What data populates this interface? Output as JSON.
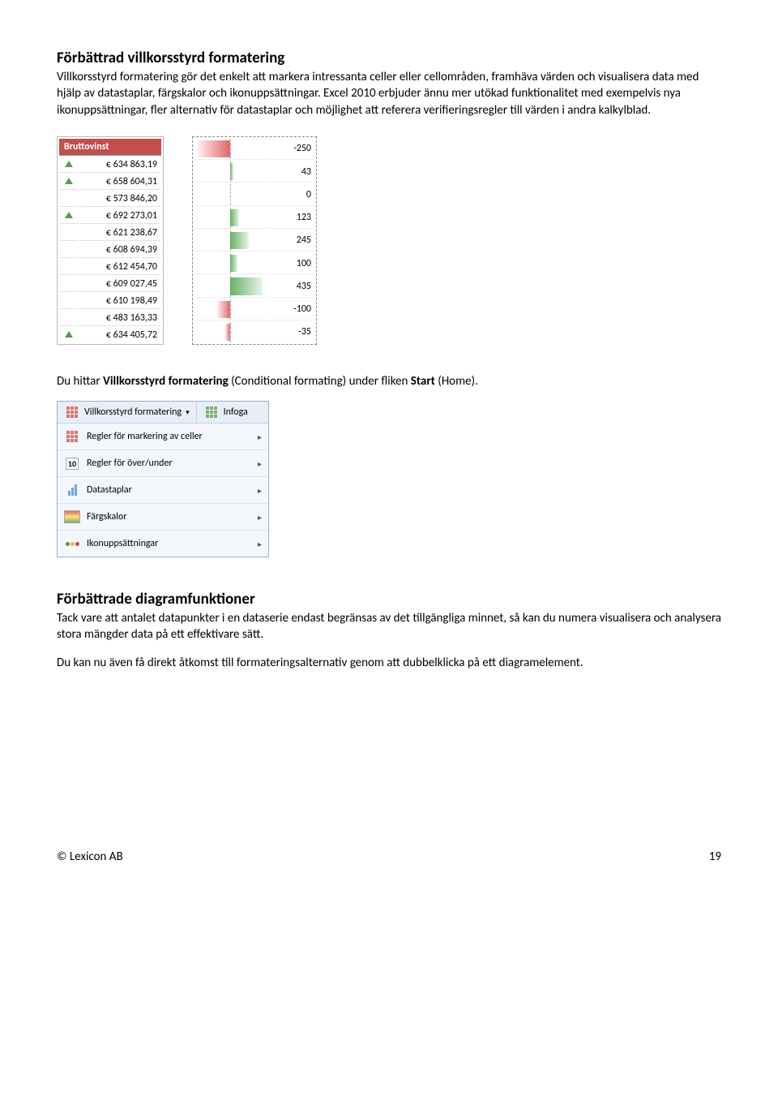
{
  "section1": {
    "heading": "Förbättrad villkorsstyrd formatering",
    "para": "Villkorsstyrd formatering gör det enkelt att markera intressanta celler eller cellområden, framhäva värden och visualisera data med hjälp av datastaplar, färgskalor och ikonuppsättningar. Excel 2010 erbjuder ännu mer utökad funktionalitet med exempelvis nya ikonuppsättningar, fler alternativ för datastaplar och möjlighet att referera verifieringsregler till värden i andra kalkylblad."
  },
  "table1": {
    "header": "Bruttovinst",
    "rows": [
      {
        "icon": true,
        "val": "€ 634 863,19"
      },
      {
        "icon": true,
        "val": "€ 658 604,31"
      },
      {
        "icon": false,
        "val": "€ 573 846,20"
      },
      {
        "icon": true,
        "val": "€ 692 273,01"
      },
      {
        "icon": false,
        "val": "€ 621 238,67"
      },
      {
        "icon": false,
        "val": "€ 608 694,39"
      },
      {
        "icon": false,
        "val": "€ 612 454,70"
      },
      {
        "icon": false,
        "val": "€ 609 027,45"
      },
      {
        "icon": false,
        "val": "€ 610 198,49"
      },
      {
        "icon": false,
        "val": "€ 483 163,33"
      },
      {
        "icon": true,
        "val": "€ 634 405,72"
      }
    ]
  },
  "table2": {
    "rows": [
      {
        "v": -250
      },
      {
        "v": 43
      },
      {
        "v": 0
      },
      {
        "v": 123
      },
      {
        "v": 245
      },
      {
        "v": 100
      },
      {
        "v": 435
      },
      {
        "v": -100
      },
      {
        "v": -35
      }
    ],
    "min": -250,
    "max": 435
  },
  "mid_line_pre": "Du hittar ",
  "mid_line_bold1": "Villkorsstyrd formatering",
  "mid_line_mid": " (Conditional formating) under fliken ",
  "mid_line_bold2": "Start",
  "mid_line_post": " (Home).",
  "cf_dropdown": {
    "btn1": "Villkorsstyrd formatering",
    "btn2": "Infoga",
    "items": [
      "Regler för markering av celler",
      "Regler för över/under",
      "Datastaplar",
      "Färgskalor",
      "Ikonuppsättningar"
    ]
  },
  "section2": {
    "heading": "Förbättrade diagramfunktioner",
    "para1": "Tack vare att antalet datapunkter i en dataserie endast begränsas av det tillgängliga minnet, så kan du numera visualisera och analysera stora mängder data på ett effektivare sätt.",
    "para2": "Du kan nu även få direkt åtkomst till formateringsalternativ genom att dubbelklicka på ett diagramelement."
  },
  "footer": {
    "left": "© Lexicon AB",
    "right": "19"
  }
}
